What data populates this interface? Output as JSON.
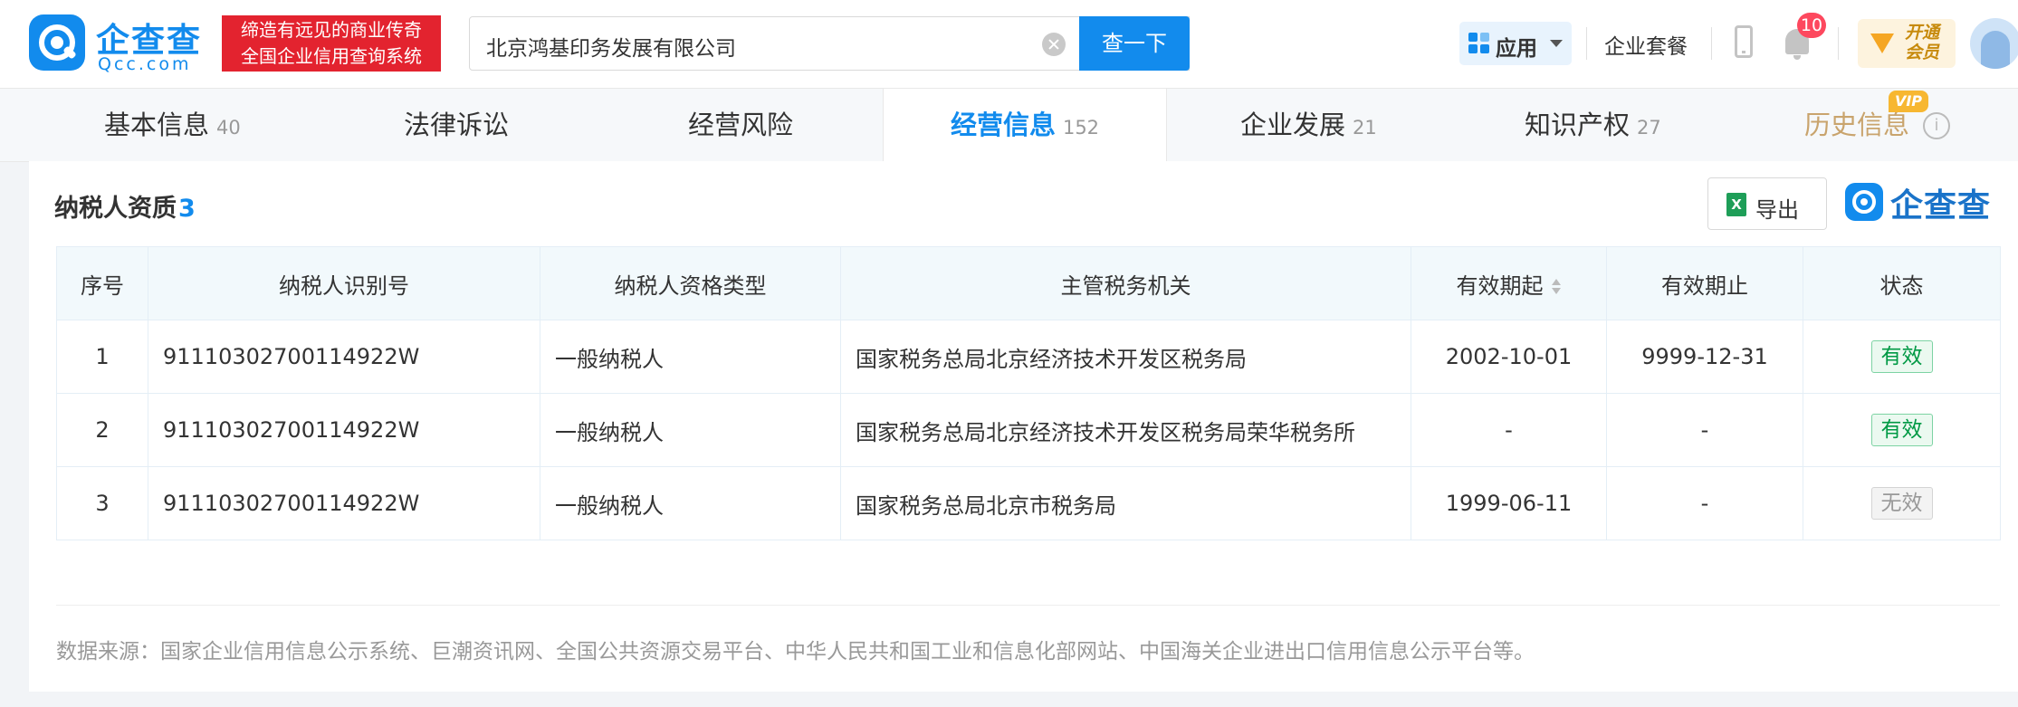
{
  "brand": {
    "name_cn": "企查查",
    "name_en": "Qcc.com",
    "slogan_line1": "缔造有远见的商业传奇",
    "slogan_line2": "全国企业信用查询系统"
  },
  "search": {
    "value": "北京鸿基印务发展有限公司",
    "button_label": "查一下"
  },
  "header": {
    "apps_label": "应用",
    "package_label": "企业套餐",
    "notification_count": "10",
    "vip_label_line1": "开通",
    "vip_label_line2": "会员"
  },
  "tabs": [
    {
      "label": "基本信息",
      "count": "40"
    },
    {
      "label": "法律诉讼",
      "count": ""
    },
    {
      "label": "经营风险",
      "count": ""
    },
    {
      "label": "经营信息",
      "count": "152",
      "active": true
    },
    {
      "label": "企业发展",
      "count": "21"
    },
    {
      "label": "知识产权",
      "count": "27"
    },
    {
      "label": "历史信息",
      "count": "",
      "tag": "VIP"
    }
  ],
  "section": {
    "title": "纳税人资质",
    "count": "3",
    "export_label": "导出",
    "watermark_logo": "企查查"
  },
  "table": {
    "headers": [
      "序号",
      "纳税人识别号",
      "纳税人资格类型",
      "主管税务机关",
      "有效期起",
      "有效期止",
      "状态"
    ],
    "rows": [
      {
        "no": "1",
        "tax_id": "91110302700114922W",
        "type": "一般纳税人",
        "authority": "国家税务总局北京经济技术开发区税务局",
        "start": "2002-10-01",
        "end": "9999-12-31",
        "status": "有效"
      },
      {
        "no": "2",
        "tax_id": "91110302700114922W",
        "type": "一般纳税人",
        "authority": "国家税务总局北京经济技术开发区税务局荣华税务所",
        "start": "-",
        "end": "-",
        "status": "有效"
      },
      {
        "no": "3",
        "tax_id": "91110302700114922W",
        "type": "一般纳税人",
        "authority": "国家税务总局北京市税务局",
        "start": "1999-06-11",
        "end": "-",
        "status": "无效"
      }
    ]
  },
  "footer": {
    "source": "数据来源：国家企业信用信息公示系统、巨潮资讯网、全国公共资源交易平台、中华人民共和国工业和信息化部网站、中国海关企业进出口信用信息公示平台等。"
  },
  "colors": {
    "brand_blue": "#128bed",
    "slogan_red": "#e3232f",
    "status_valid": "#009944",
    "status_invalid": "#999999"
  },
  "icons": [
    "qcc-logo-icon",
    "clear-icon",
    "apps-grid-icon",
    "chevron-down-icon",
    "phone-icon",
    "bell-icon",
    "vip-crown-icon",
    "avatar",
    "info-icon",
    "excel-icon",
    "sort-icon"
  ]
}
